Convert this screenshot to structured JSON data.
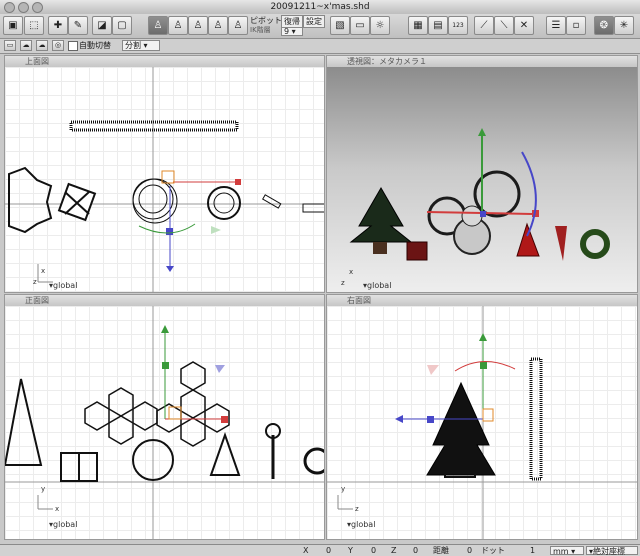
{
  "window": {
    "title": "20091211~x'mas.shd"
  },
  "toolbar": {
    "pivot_label": "ピボット",
    "restore_label": "復帰",
    "settings_label": "設定",
    "ik_label": "IK階層",
    "ik_value": "9",
    "grid_count": "123"
  },
  "toolbar2": {
    "auto_switch_label": "自動切替",
    "mode_select_value": "分割"
  },
  "viewports": {
    "top": {
      "title": "上面図",
      "coord": "global",
      "axis_x": "x",
      "axis_y": "z"
    },
    "perspective": {
      "title": "透視図：メタカメラ１",
      "coord": "global",
      "axis_x": "x",
      "axis_y": "z"
    },
    "front": {
      "title": "正面図",
      "coord": "global",
      "axis_x": "x",
      "axis_y": "y"
    },
    "right": {
      "title": "右面図",
      "coord": "global",
      "axis_x": "z",
      "axis_y": "y"
    }
  },
  "status": {
    "x_label": "X",
    "x_value": "0",
    "y_label": "Y",
    "y_value": "0",
    "z_label": "Z",
    "z_value": "0",
    "dist_label": "距離",
    "dist_value": "0",
    "dot_label": "ドット",
    "dot_value": "1",
    "unit": "mm",
    "coord_mode": "絶対座標"
  },
  "colors": {
    "x_axis": "#d23c3c",
    "y_axis": "#3a9a3a",
    "z_axis": "#4747c8",
    "manip_orange": "#e08a2a"
  }
}
